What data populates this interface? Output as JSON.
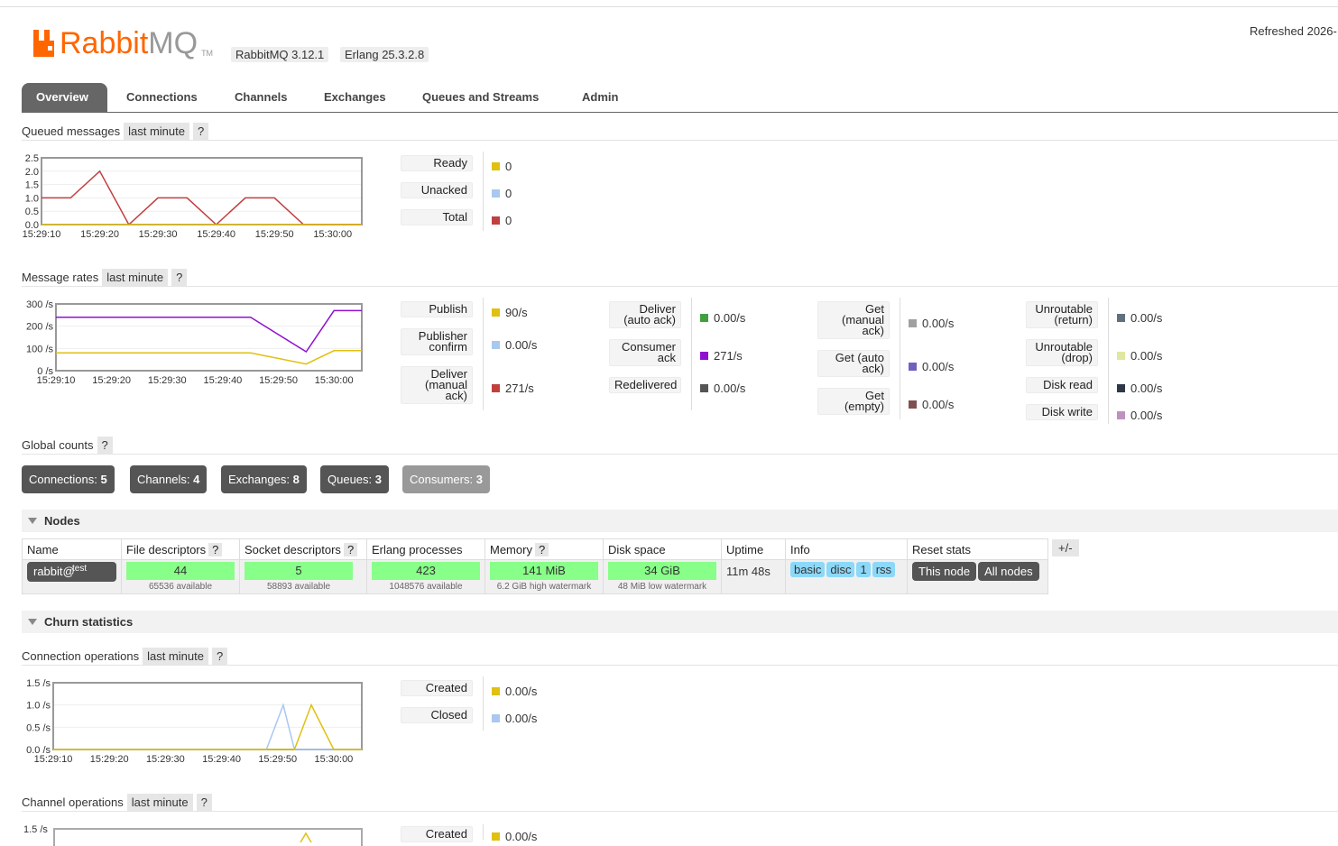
{
  "header": {
    "logo_text_a": "Rabbit",
    "logo_text_b": "MQ",
    "tm": "TM",
    "rabbitmq_version": "RabbitMQ 3.12.1",
    "erlang_version": "Erlang 25.3.2.8",
    "refreshed": "Refreshed 2026-"
  },
  "tabs": [
    "Overview",
    "Connections",
    "Channels",
    "Exchanges",
    "Queues and Streams",
    "Admin"
  ],
  "queued_messages": {
    "title": "Queued messages",
    "range": "last minute",
    "help": "?",
    "legend": [
      {
        "label": "Ready",
        "value": "0",
        "color": "#e0c010"
      },
      {
        "label": "Unacked",
        "value": "0",
        "color": "#a8c8f0"
      },
      {
        "label": "Total",
        "value": "0",
        "color": "#c04040"
      }
    ],
    "chart_data": {
      "type": "line",
      "x": [
        "15:29:10",
        "15:29:15",
        "15:29:20",
        "15:29:25",
        "15:29:30",
        "15:29:35",
        "15:29:40",
        "15:29:45",
        "15:29:50",
        "15:29:55",
        "15:30:00",
        "15:30:05"
      ],
      "x_tick_labels": [
        "15:29:10",
        "15:29:20",
        "15:29:30",
        "15:29:40",
        "15:29:50",
        "15:30:00"
      ],
      "y_tick_labels": [
        "2.5",
        "2.0",
        "1.5",
        "1.0",
        "0.5",
        "0.0"
      ],
      "ylim": [
        0,
        2.5
      ],
      "series": [
        {
          "values": [
            1,
            1,
            2,
            0,
            1,
            1,
            0,
            1,
            1,
            0,
            0,
            0
          ],
          "color": "#c04040"
        },
        {
          "values": [
            0,
            0,
            0,
            0,
            0,
            0,
            0,
            0,
            0,
            0,
            0,
            0
          ],
          "color": "#e0c010"
        }
      ]
    }
  },
  "message_rates": {
    "title": "Message rates",
    "range": "last minute",
    "help": "?",
    "col1": [
      {
        "label": "Publish",
        "value": "90/s",
        "color": "#e0c010"
      },
      {
        "label": "Publisher confirm",
        "value": "0.00/s",
        "color": "#a8c8f0"
      },
      {
        "label": "Deliver (manual ack)",
        "value": "271/s",
        "color": "#c04040"
      }
    ],
    "col2": [
      {
        "label": "Deliver (auto ack)",
        "value": "0.00/s",
        "color": "#40a040"
      },
      {
        "label": "Consumer ack",
        "value": "271/s",
        "color": "#9010d0"
      },
      {
        "label": "Redelivered",
        "value": "0.00/s",
        "color": "#555555"
      }
    ],
    "col3": [
      {
        "label": "Get (manual ack)",
        "value": "0.00/s",
        "color": "#a0a0a0"
      },
      {
        "label": "Get (auto ack)",
        "value": "0.00/s",
        "color": "#7060c0"
      },
      {
        "label": "Get (empty)",
        "value": "0.00/s",
        "color": "#805050"
      }
    ],
    "col4": [
      {
        "label": "Unroutable (return)",
        "value": "0.00/s",
        "color": "#607080"
      },
      {
        "label": "Unroutable (drop)",
        "value": "0.00/s",
        "color": "#e0e8a0"
      },
      {
        "label": "Disk read",
        "value": "0.00/s",
        "color": "#303848"
      },
      {
        "label": "Disk write",
        "value": "0.00/s",
        "color": "#c090c0"
      }
    ],
    "chart_data": {
      "type": "line",
      "x": [
        "15:29:10",
        "15:29:45",
        "15:29:55",
        "15:30:00",
        "15:30:05"
      ],
      "x_tick_labels": [
        "15:29:10",
        "15:29:20",
        "15:29:30",
        "15:29:40",
        "15:29:50",
        "15:30:00"
      ],
      "y_tick_labels": [
        "300 /s",
        "200 /s",
        "100 /s",
        "0 /s"
      ],
      "ylim": [
        0,
        300
      ],
      "series": [
        {
          "values": [
            240,
            240,
            85,
            270,
            270
          ],
          "color": "#9010d0"
        },
        {
          "values": [
            80,
            80,
            30,
            90,
            90
          ],
          "color": "#e0c010"
        }
      ]
    }
  },
  "global_counts": {
    "title": "Global counts",
    "help": "?",
    "buttons": [
      {
        "label": "Connections:",
        "count": "5"
      },
      {
        "label": "Channels:",
        "count": "4"
      },
      {
        "label": "Exchanges:",
        "count": "8"
      },
      {
        "label": "Queues:",
        "count": "3"
      },
      {
        "label": "Consumers:",
        "count": "3"
      }
    ]
  },
  "nodes": {
    "title": "Nodes",
    "headers": [
      "Name",
      "File descriptors",
      "Socket descriptors",
      "Erlang processes",
      "Memory",
      "Disk space",
      "Uptime",
      "Info",
      "Reset stats"
    ],
    "help": "?",
    "plus_minus": "+/-",
    "row": {
      "name": "rabbit@",
      "name_tag": "test",
      "fd_value": "44",
      "fd_sub": "65536 available",
      "sd_value": "5",
      "sd_sub": "58893 available",
      "ep_value": "423",
      "ep_sub": "1048576 available",
      "mem_value": "141 MiB",
      "mem_sub": "6.2 GiB high watermark",
      "disk_value": "34 GiB",
      "disk_sub": "48 MiB low watermark",
      "uptime": "11m 48s",
      "info": [
        "basic",
        "disc",
        "1",
        "rss"
      ],
      "reset_this": "This node",
      "reset_all": "All nodes"
    }
  },
  "churn": {
    "title": "Churn statistics",
    "connection_ops": {
      "title": "Connection operations",
      "range": "last minute",
      "help": "?",
      "legend": [
        {
          "label": "Created",
          "value": "0.00/s",
          "color": "#e0c010"
        },
        {
          "label": "Closed",
          "value": "0.00/s",
          "color": "#a8c8f0"
        }
      ],
      "chart_data": {
        "type": "line",
        "x": [
          "15:29:10",
          "15:29:46",
          "15:29:48",
          "15:29:51",
          "15:29:53",
          "15:29:56",
          "15:30:00",
          "15:30:05"
        ],
        "x_tick_labels": [
          "15:29:10",
          "15:29:20",
          "15:29:30",
          "15:29:40",
          "15:29:50",
          "15:30:00"
        ],
        "y_tick_labels": [
          "1.5 /s",
          "1.0 /s",
          "0.5 /s",
          "0.0 /s"
        ],
        "ylim": [
          0,
          1.5
        ],
        "series": [
          {
            "values": [
              0,
              0,
              0,
              1.0,
              0,
              0,
              0,
              0
            ],
            "color": "#a8c8f0"
          },
          {
            "values": [
              0,
              0,
              0,
              0,
              0,
              1.0,
              0,
              0
            ],
            "color": "#e0c010"
          }
        ]
      }
    },
    "channel_ops": {
      "title": "Channel operations",
      "range": "last minute",
      "help": "?",
      "y_top": "1.5 /s",
      "legend": [
        {
          "label": "Created",
          "value": "0.00/s",
          "color": "#e0c010"
        }
      ]
    }
  }
}
